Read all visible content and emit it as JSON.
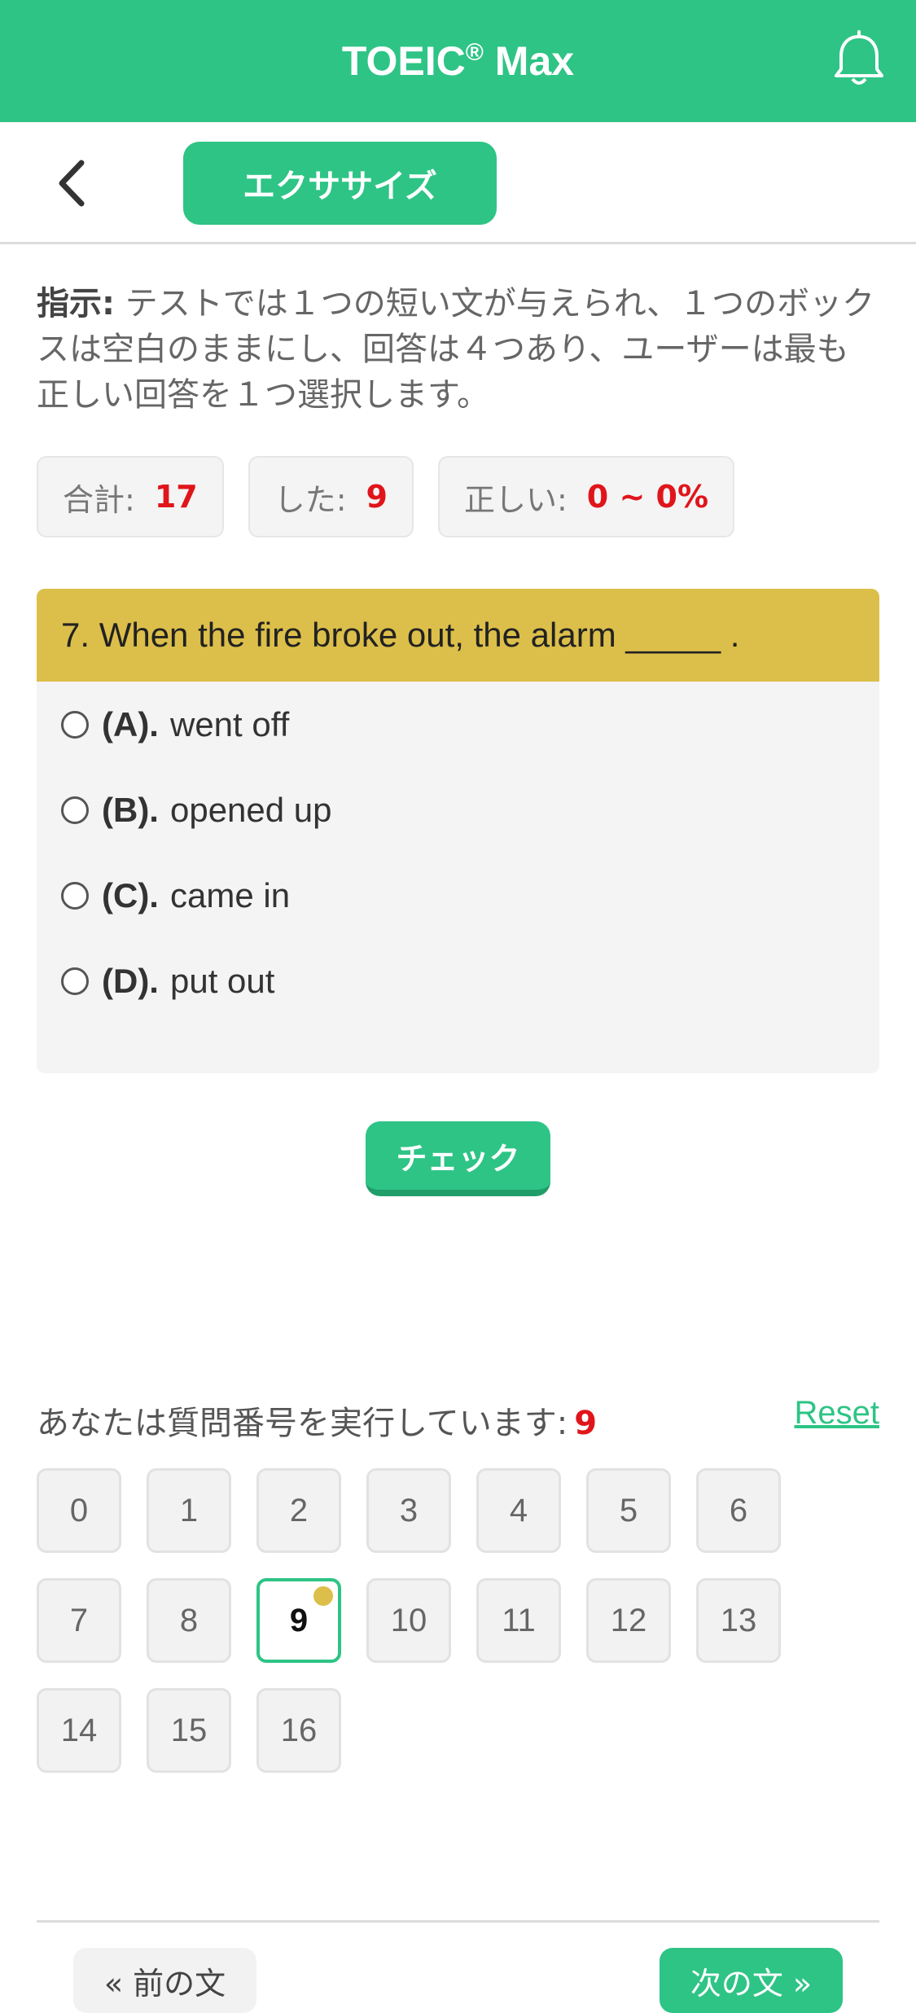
{
  "header": {
    "title": "TOEIC",
    "title_mark": "®",
    "title_suffix": " Max",
    "bell_icon": "bell-icon"
  },
  "toolbar": {
    "back_icon": "chevron-left-icon",
    "tab_label": "エクササイズ"
  },
  "instruction": {
    "label": "指示:",
    "text": " テストでは１つの短い文が与えられ、１つのボックスは空白のままにし、回答は４つあり、ユーザーは最も正しい回答を１つ選択します。"
  },
  "stats": {
    "total_label": "合計:",
    "total_value": "17",
    "done_label": "した:",
    "done_value": "9",
    "correct_label": "正しい:",
    "correct_value": "0 ~ 0%"
  },
  "question": {
    "text": "7. When the fire broke out, the alarm _____ .",
    "options": [
      {
        "key": "(A).",
        "text": "went off"
      },
      {
        "key": "(B).",
        "text": "opened up"
      },
      {
        "key": "(C).",
        "text": "came in"
      },
      {
        "key": "(D).",
        "text": "put out"
      }
    ]
  },
  "check_label": "チェック",
  "progress": {
    "label": "あなたは質問番号を実行しています:",
    "current": "9",
    "reset_label": "Reset",
    "numbers": [
      "0",
      "1",
      "2",
      "3",
      "4",
      "5",
      "6",
      "7",
      "8",
      "9",
      "10",
      "11",
      "12",
      "13",
      "14",
      "15",
      "16"
    ]
  },
  "nav": {
    "prev_label": "« 前の文",
    "next_label": "次の文 »"
  },
  "colors": {
    "primary": "#2ec486",
    "question_bar": "#dcbf4a",
    "highlight_red": "#e0151b"
  }
}
